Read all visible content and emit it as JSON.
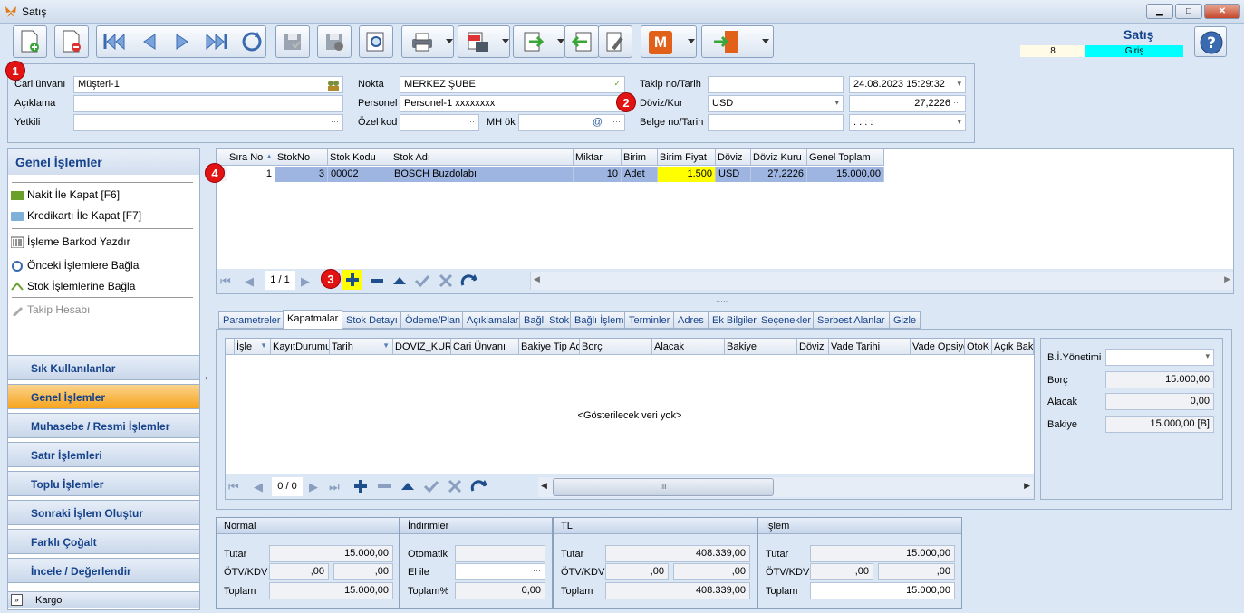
{
  "window": {
    "title": "Satış",
    "minimize": "▁",
    "maximize": "□",
    "close": "✕"
  },
  "toolbar_right": {
    "title": "Satış",
    "count": "8",
    "mode": "Giriş"
  },
  "badges": {
    "b1": "1",
    "b2": "2",
    "b3": "3",
    "b4": "4"
  },
  "header": {
    "cari_unvani_label": "Cari ünvanı",
    "cari_unvani": "Müşteri-1",
    "aciklama_label": "Açıklama",
    "aciklama": "",
    "yetkili_label": "Yetkili",
    "yetkili": "",
    "nokta_label": "Nokta",
    "nokta": "MERKEZ ŞUBE",
    "personel_label": "Personel",
    "personel": "Personel-1 xxxxxxxx",
    "ozel_kod_label": "Özel kod",
    "ozel_kod": "",
    "mh_ok_label": "MH ök",
    "mh_ok": "",
    "takip_label": "Takip no/Tarih",
    "takip_no": "",
    "tarih": "24.08.2023 15:29:32",
    "doviz_label": "Döviz/Kur",
    "doviz": "USD",
    "kur": "27,2226",
    "belge_label": "Belge no/Tarih",
    "belge_no": "",
    "belge_tarih": ". .   : :"
  },
  "left": {
    "title": "Genel İşlemler",
    "items": [
      "Nakit İle Kapat [F6]",
      "Kredikartı İle Kapat [F7]",
      "İşleme Barkod Yazdır",
      "Önceki İşlemlere Bağla",
      "Stok İşlemlerine Bağla",
      "Takip Hesabı"
    ],
    "sections": [
      "Sık Kullanılanlar",
      "Genel İşlemler",
      "Muhasebe / Resmi İşlemler",
      "Satır İşlemleri",
      "Toplu İşlemler",
      "Sonraki İşlem Oluştur",
      "Farklı Çoğalt",
      "İncele / Değerlendir"
    ],
    "kargo": "Kargo"
  },
  "grid": {
    "columns": [
      "Sıra No",
      "StokNo",
      "Stok Kodu",
      "Stok Adı",
      "Miktar",
      "Birim",
      "Birim Fiyat",
      "Döviz",
      "Döviz Kuru",
      "Genel Toplam"
    ],
    "row": [
      "1",
      "3",
      "00002",
      "BOSCH Buzdolabı",
      "10",
      "Adet",
      "1.500",
      "USD",
      "27,2226",
      "15.000,00"
    ],
    "pager": "1 / 1"
  },
  "tabs": [
    "Parametreler",
    "Kapatmalar",
    "Stok Detayı",
    "Ödeme/Plan",
    "Açıklamalar",
    "Bağlı Stok",
    "Bağlı İşlem",
    "Terminler",
    "Adres",
    "Ek Bilgiler",
    "Seçenekler",
    "Serbest Alanlar",
    "Gizle"
  ],
  "kapatma": {
    "columns": [
      "İşle",
      "KayıtDurumu",
      "Tarih",
      "DOVIZ_KURU",
      "Cari Ünvanı",
      "Bakiye Tip Ac",
      "Borç",
      "Alacak",
      "Bakiye",
      "Döviz",
      "Vade Tarihi",
      "Vade Opsiyon",
      "OtoK",
      "Açık Bakiye"
    ],
    "empty": "<Gösterilecek veri yok>",
    "pager": "0 / 0",
    "scroll_grip": "III"
  },
  "balance": {
    "bi_label": "B.İ.Yönetimi",
    "bi": "",
    "borc_label": "Borç",
    "borc": "15.000,00",
    "alacak_label": "Alacak",
    "alacak": "0,00",
    "bakiye_label": "Bakiye",
    "bakiye": "15.000,00 [B]"
  },
  "totals": {
    "normal": {
      "title": "Normal",
      "tutar_label": "Tutar",
      "tutar": "15.000,00",
      "otv_label": "ÖTV/KDV",
      "otv": ",00",
      "kdv": ",00",
      "toplam_label": "Toplam",
      "toplam": "15.000,00"
    },
    "indirim": {
      "title": "İndirimler",
      "otomatik_label": "Otomatik",
      "otomatik": "",
      "elile_label": "El ile",
      "elile": "",
      "toplam_label": "Toplam%",
      "toplam": "0,00"
    },
    "tl": {
      "title": "TL",
      "tutar_label": "Tutar",
      "tutar": "408.339,00",
      "otv_label": "ÖTV/KDV",
      "otv": ",00",
      "kdv": ",00",
      "toplam_label": "Toplam",
      "toplam": "408.339,00"
    },
    "islem": {
      "title": "İşlem",
      "tutar_label": "Tutar",
      "tutar": "15.000,00",
      "otv_label": "ÖTV/KDV",
      "otv": ",00",
      "kdv": ",00",
      "toplam_label": "Toplam",
      "toplam": "15.000,00"
    }
  },
  "colors": {
    "accent": "#15428b",
    "highlight": "#ffff00",
    "selected": "#9db5e0",
    "mode": "#00ffff"
  }
}
